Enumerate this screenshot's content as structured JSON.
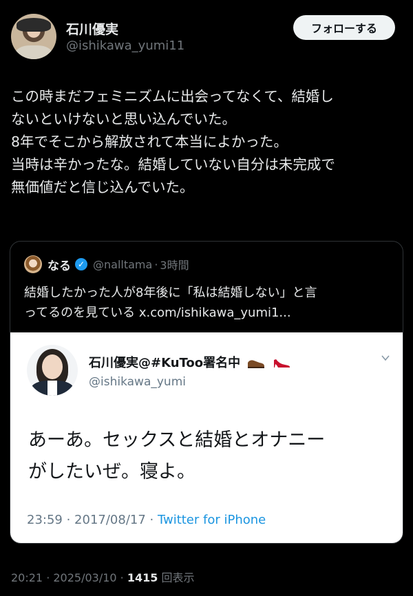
{
  "author": {
    "display_name": "石川優実",
    "handle": "@ishikawa_yumi11",
    "follow_label": "フォローする"
  },
  "tweet": {
    "lines": [
      "この時まだフェミニズムに出会ってなくて、結婚し",
      "ないといけないと思い込んでいた。",
      "8年でそこから解放されて本当によかった。",
      "当時は辛かったな。結婚していない自分は未完成で",
      "無価値だと信じ込んでいた。"
    ]
  },
  "quote": {
    "name": "なる",
    "handle": "@nalltama",
    "separator": "·",
    "time": "3時間",
    "lines": [
      "結婚したかった人が8年後に「私は結婚しない」と言",
      "ってるのを見ている x.com/ishikawa_yumi1..."
    ],
    "embed": {
      "name": "石川優実@#KuToo署名中",
      "handle": "@ishikawa_yumi",
      "lines": [
        "あーあ。セックスと結婚とオナニー",
        "がしたいぜ。寝よ。"
      ],
      "meta_time": "23:59 · 2017/08/17 · ",
      "meta_source": "Twitter for iPhone"
    }
  },
  "footer": {
    "timestamp": "20:21 · 2025/03/10 · ",
    "views_count": "1415",
    "views_label": " 回表示"
  },
  "colors": {
    "background": "#000000",
    "text": "#e7e9ea",
    "muted": "#71767b",
    "verified": "#1d9bf0",
    "link": "#1b95e0"
  },
  "icons": [
    "verified-badge-icon",
    "chevron-down-icon",
    "shoe-icon"
  ]
}
